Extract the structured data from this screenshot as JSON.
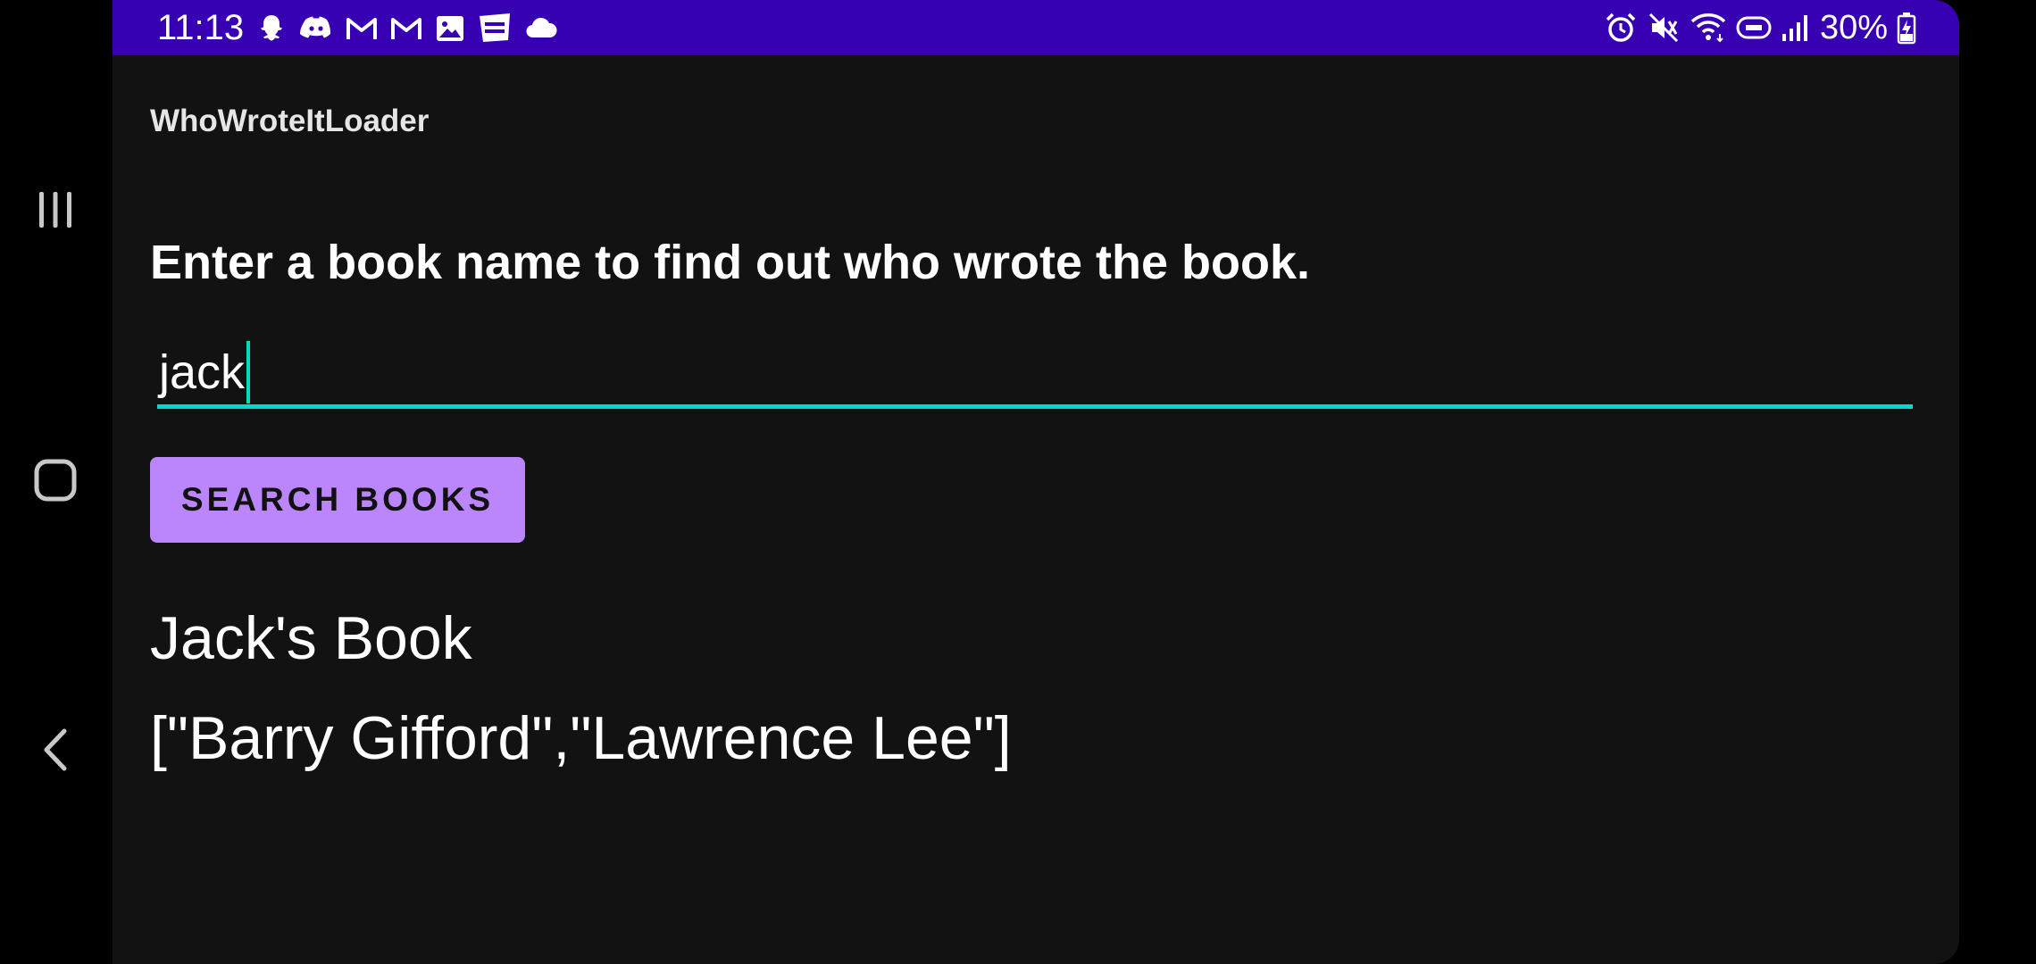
{
  "status_bar": {
    "time": "11:13",
    "notification_icons": [
      "snapchat-icon",
      "discord-icon",
      "gmail-icon",
      "gmail-icon",
      "gallery-icon",
      "webtoon-icon",
      "cloud-icon"
    ],
    "right_icons": [
      "alarm-icon",
      "mute-icon",
      "wifi-icon",
      "volte-icon",
      "signal-icon"
    ],
    "battery": "30%"
  },
  "app": {
    "title": "WhoWroteItLoader",
    "instructions": "Enter a book name to find out who wrote the book.",
    "search": {
      "value": "jack"
    },
    "search_button_label": "SEARCH BOOKS",
    "result": {
      "title": "Jack's Book",
      "authors": "[\"Barry Gifford\",\"Lawrence Lee\"]"
    }
  },
  "colors": {
    "status_bar": "#3700b3",
    "background": "#121212",
    "accent": "#03dac5",
    "button": "#bb86fc"
  },
  "nav": {
    "icons": [
      "recents-icon",
      "home-icon",
      "back-icon"
    ]
  }
}
